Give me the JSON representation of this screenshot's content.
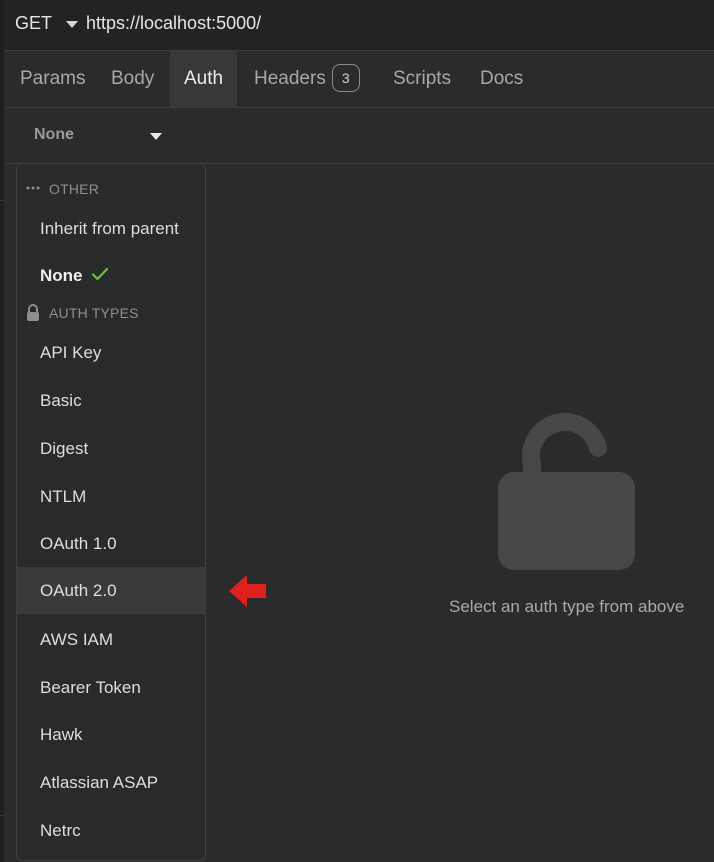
{
  "request": {
    "method": "GET",
    "url": "https://localhost:5000/"
  },
  "tabs": [
    {
      "label": "Params"
    },
    {
      "label": "Body"
    },
    {
      "label": "Auth"
    },
    {
      "label": "Headers",
      "badge": "3"
    },
    {
      "label": "Scripts"
    },
    {
      "label": "Docs"
    }
  ],
  "auth": {
    "selected": "None"
  },
  "dropdown": {
    "section_other": "OTHER",
    "inherit": "Inherit from parent",
    "none": "None",
    "section_auth_types": "AUTH TYPES",
    "items": [
      "API Key",
      "Basic",
      "Digest",
      "NTLM",
      "OAuth 1.0",
      "OAuth 2.0",
      "AWS IAM",
      "Bearer Token",
      "Hawk",
      "Atlassian ASAP",
      "Netrc"
    ],
    "highlighted": "OAuth 2.0"
  },
  "empty_state": {
    "text": "Select an auth type from above",
    "icon": "unlock-icon"
  },
  "colors": {
    "check": "#6cc04a",
    "arrow": "#e0201f",
    "background": "#2b2b2b"
  }
}
